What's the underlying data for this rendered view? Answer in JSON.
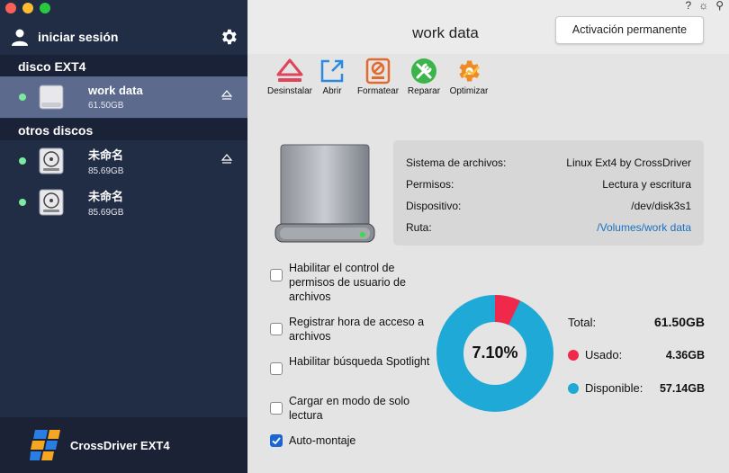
{
  "sidebar": {
    "login_label": "iniciar sesión",
    "sections": [
      {
        "label": "disco EXT4"
      },
      {
        "label": "otros discos"
      }
    ],
    "disks": [
      {
        "name": "work data",
        "size": "61.50GB"
      },
      {
        "name": "未命名",
        "size": "85.69GB"
      },
      {
        "name": "未命名",
        "size": "85.69GB"
      }
    ],
    "footer_brand": "CrossDriver EXT4"
  },
  "header": {
    "title": "work data",
    "activate_button": "Activación permanente",
    "help_glyph": "?",
    "brightness_glyph": "☼",
    "pin_glyph": "⚲"
  },
  "toolbar": {
    "items": [
      {
        "label": "Desinstalar",
        "icon": "eject-icon"
      },
      {
        "label": "Abrir",
        "icon": "open-external-icon"
      },
      {
        "label": "Formatear",
        "icon": "format-icon"
      },
      {
        "label": "Reparar",
        "icon": "repair-icon"
      },
      {
        "label": "Optimizar",
        "icon": "optimize-icon"
      }
    ]
  },
  "info": {
    "rows": [
      {
        "key": "Sistema de archivos:",
        "value": "Linux Ext4 by CrossDriver"
      },
      {
        "key": "Permisos:",
        "value": "Lectura y escritura"
      },
      {
        "key": "Dispositivo:",
        "value": "/dev/disk3s1"
      },
      {
        "key": "Ruta:",
        "value": "/Volumes/work data"
      }
    ]
  },
  "options": [
    {
      "label": "Habilitar el control de permisos de usuario de archivos",
      "checked": false
    },
    {
      "label": "Registrar hora de acceso a archivos",
      "checked": false
    },
    {
      "label": "Habilitar búsqueda Spotlight",
      "checked": false
    },
    {
      "label": "Cargar en modo de solo lectura",
      "checked": false
    },
    {
      "label": "Auto-montaje",
      "checked": true
    }
  ],
  "usage": {
    "percent_label": "7.10%",
    "used_fraction": 0.071,
    "total_label": "Total:",
    "total_value": "61.50GB",
    "used_label": "Usado:",
    "used_value": "4.36GB",
    "free_label": "Disponible:",
    "free_value": "57.14GB",
    "used_color": "#f0284a",
    "free_color": "#1fa9d6"
  },
  "colors": {
    "sidebar_bg": "#212c45",
    "selected_bg": "#5b6a8d",
    "accent": "#1b64d3",
    "status_dot": "#7be9a0"
  }
}
